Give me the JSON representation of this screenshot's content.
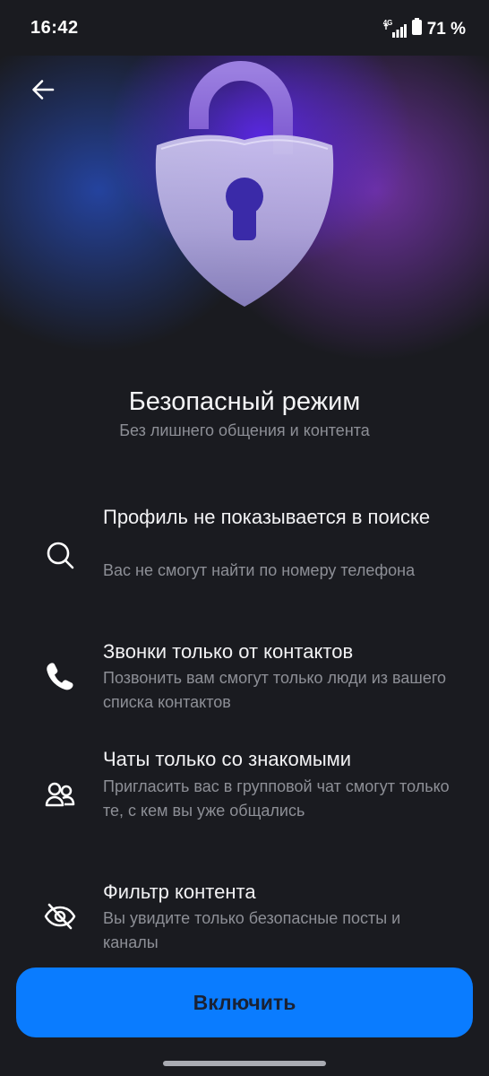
{
  "status_bar": {
    "time": "16:42",
    "network": "4G",
    "battery": "71 %"
  },
  "navigation": {
    "back_icon": "arrow-left-icon"
  },
  "hero": {
    "icon": "padlock-shield-icon"
  },
  "header": {
    "title": "Безопасный режим",
    "subtitle": "Без лишнего общения и контента"
  },
  "features": [
    {
      "icon": "search-icon",
      "title": "Профиль не показывается в поиске",
      "description": "Вас не смогут найти по номеру телефона"
    },
    {
      "icon": "phone-icon",
      "title": "Звонки только от контактов",
      "description": "Позвонить вам смогут только люди из вашего списка контактов"
    },
    {
      "icon": "people-icon",
      "title": "Чаты только со знакомыми",
      "description": "Пригласить вас в групповой чат смогут только те, с кем вы уже общались"
    },
    {
      "icon": "eye-off-icon",
      "title": "Фильтр контента",
      "description": "Вы увидите только безопасные посты и каналы"
    }
  ],
  "action": {
    "enable_label": "Включить"
  },
  "colors": {
    "background": "#1a1b20",
    "accent": "#0a7cff",
    "secondary_text": "#8d8f96"
  }
}
